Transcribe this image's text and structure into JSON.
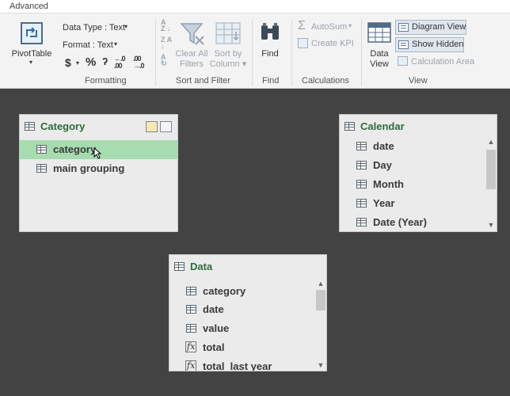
{
  "tab": {
    "label": "Advanced"
  },
  "ribbon": {
    "pivottable": {
      "label": "PivotTable"
    },
    "formatting": {
      "group_label": "Formatting",
      "data_type": "Data Type : Text",
      "format": "Format : Text",
      "currency_symbol": "$",
      "percent_symbol": "%",
      "comma_symbol": "ʔ",
      "increase_decimal": "←.0 .00",
      "decrease_decimal": ".00 →.0"
    },
    "sort_filter": {
      "group_label": "Sort and Filter",
      "clear_all_filters": [
        "Clear All",
        "Filters"
      ],
      "sort_by_column": [
        "Sort by",
        "Column"
      ]
    },
    "find": {
      "group_label": "Find",
      "label": "Find"
    },
    "calculations": {
      "group_label": "Calculations",
      "autosum": "AutoSum",
      "create_kpi": "Create KPI"
    },
    "view": {
      "group_label": "View",
      "data_view": [
        "Data",
        "View"
      ],
      "diagram_view": "Diagram View",
      "show_hidden": "Show Hidden",
      "calculation_area": "Calculation Area"
    }
  },
  "tables": {
    "category": {
      "title": "Category",
      "columns": [
        "category",
        "main grouping"
      ],
      "selected_index": 0
    },
    "calendar": {
      "title": "Calendar",
      "columns": [
        "date",
        "Day",
        "Month",
        "Year",
        "Date (Year)"
      ]
    },
    "data": {
      "title": "Data",
      "columns": [
        {
          "label": "category",
          "kind": "column"
        },
        {
          "label": "date",
          "kind": "column"
        },
        {
          "label": "value",
          "kind": "column"
        },
        {
          "label": "total",
          "kind": "measure"
        },
        {
          "label": "total_last year",
          "kind": "measure"
        }
      ]
    }
  },
  "colors": {
    "title_green": "#2e6b3a",
    "selection": "#a6dcae",
    "canvas": "#434343"
  }
}
